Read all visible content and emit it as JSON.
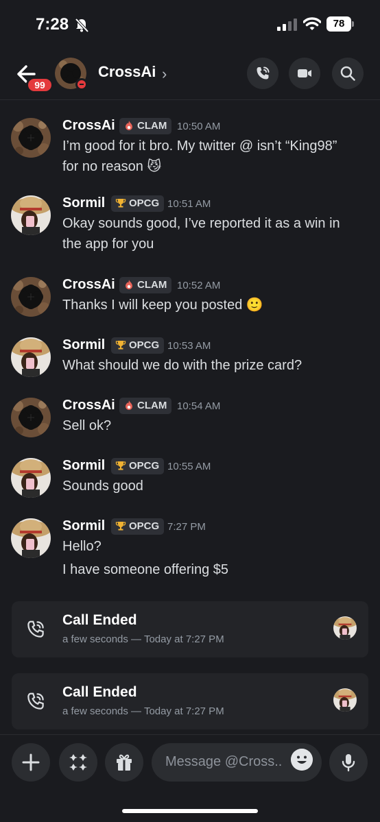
{
  "status_bar": {
    "time": "7:28",
    "battery": "78"
  },
  "header": {
    "unread_count": "99",
    "title": "CrossAi",
    "chevron": "›"
  },
  "messages": [
    {
      "author": "CrossAi",
      "tag": "CLAM",
      "time": "10:50 AM",
      "lines": [
        "I’m good for it bro. My twitter @ isn’t “King98”",
        "for no reason 😼"
      ]
    },
    {
      "author": "Sormil",
      "tag": "OPCG",
      "time": "10:51 AM",
      "lines": [
        "Okay sounds good, I’ve reported it as a win in",
        "the app for you"
      ]
    },
    {
      "author": "CrossAi",
      "tag": "CLAM",
      "time": "10:52 AM",
      "lines": [
        "Thanks I will keep you posted 🙂"
      ]
    },
    {
      "author": "Sormil",
      "tag": "OPCG",
      "time": "10:53 AM",
      "lines": [
        "What should we do with the prize card?"
      ]
    },
    {
      "author": "CrossAi",
      "tag": "CLAM",
      "time": "10:54 AM",
      "lines": [
        "Sell ok?"
      ]
    },
    {
      "author": "Sormil",
      "tag": "OPCG",
      "time": "10:55 AM",
      "lines": [
        "Sounds good"
      ]
    },
    {
      "author": "Sormil",
      "tag": "OPCG",
      "time": "7:27 PM",
      "lines": [
        "Hello?",
        "I have someone offering $5"
      ]
    }
  ],
  "calls": [
    {
      "title": "Call Ended",
      "subtitle": "a few seconds — Today at 7:27 PM"
    },
    {
      "title": "Call Ended",
      "subtitle": "a few seconds — Today at 7:27 PM"
    }
  ],
  "composer": {
    "placeholder": "Message @Cross.."
  },
  "colors": {
    "background": "#1a1b1f",
    "card": "#232428",
    "button": "#2b2d31",
    "badge_red": "#e43a3d",
    "muted_text": "#949ba4"
  },
  "icons": [
    "bell-slash-icon",
    "signal-icon",
    "wifi-icon",
    "back-arrow-icon",
    "phone-call-icon",
    "video-icon",
    "search-icon",
    "plus-icon",
    "apps-icon",
    "gift-icon",
    "emoji-icon",
    "microphone-icon"
  ]
}
